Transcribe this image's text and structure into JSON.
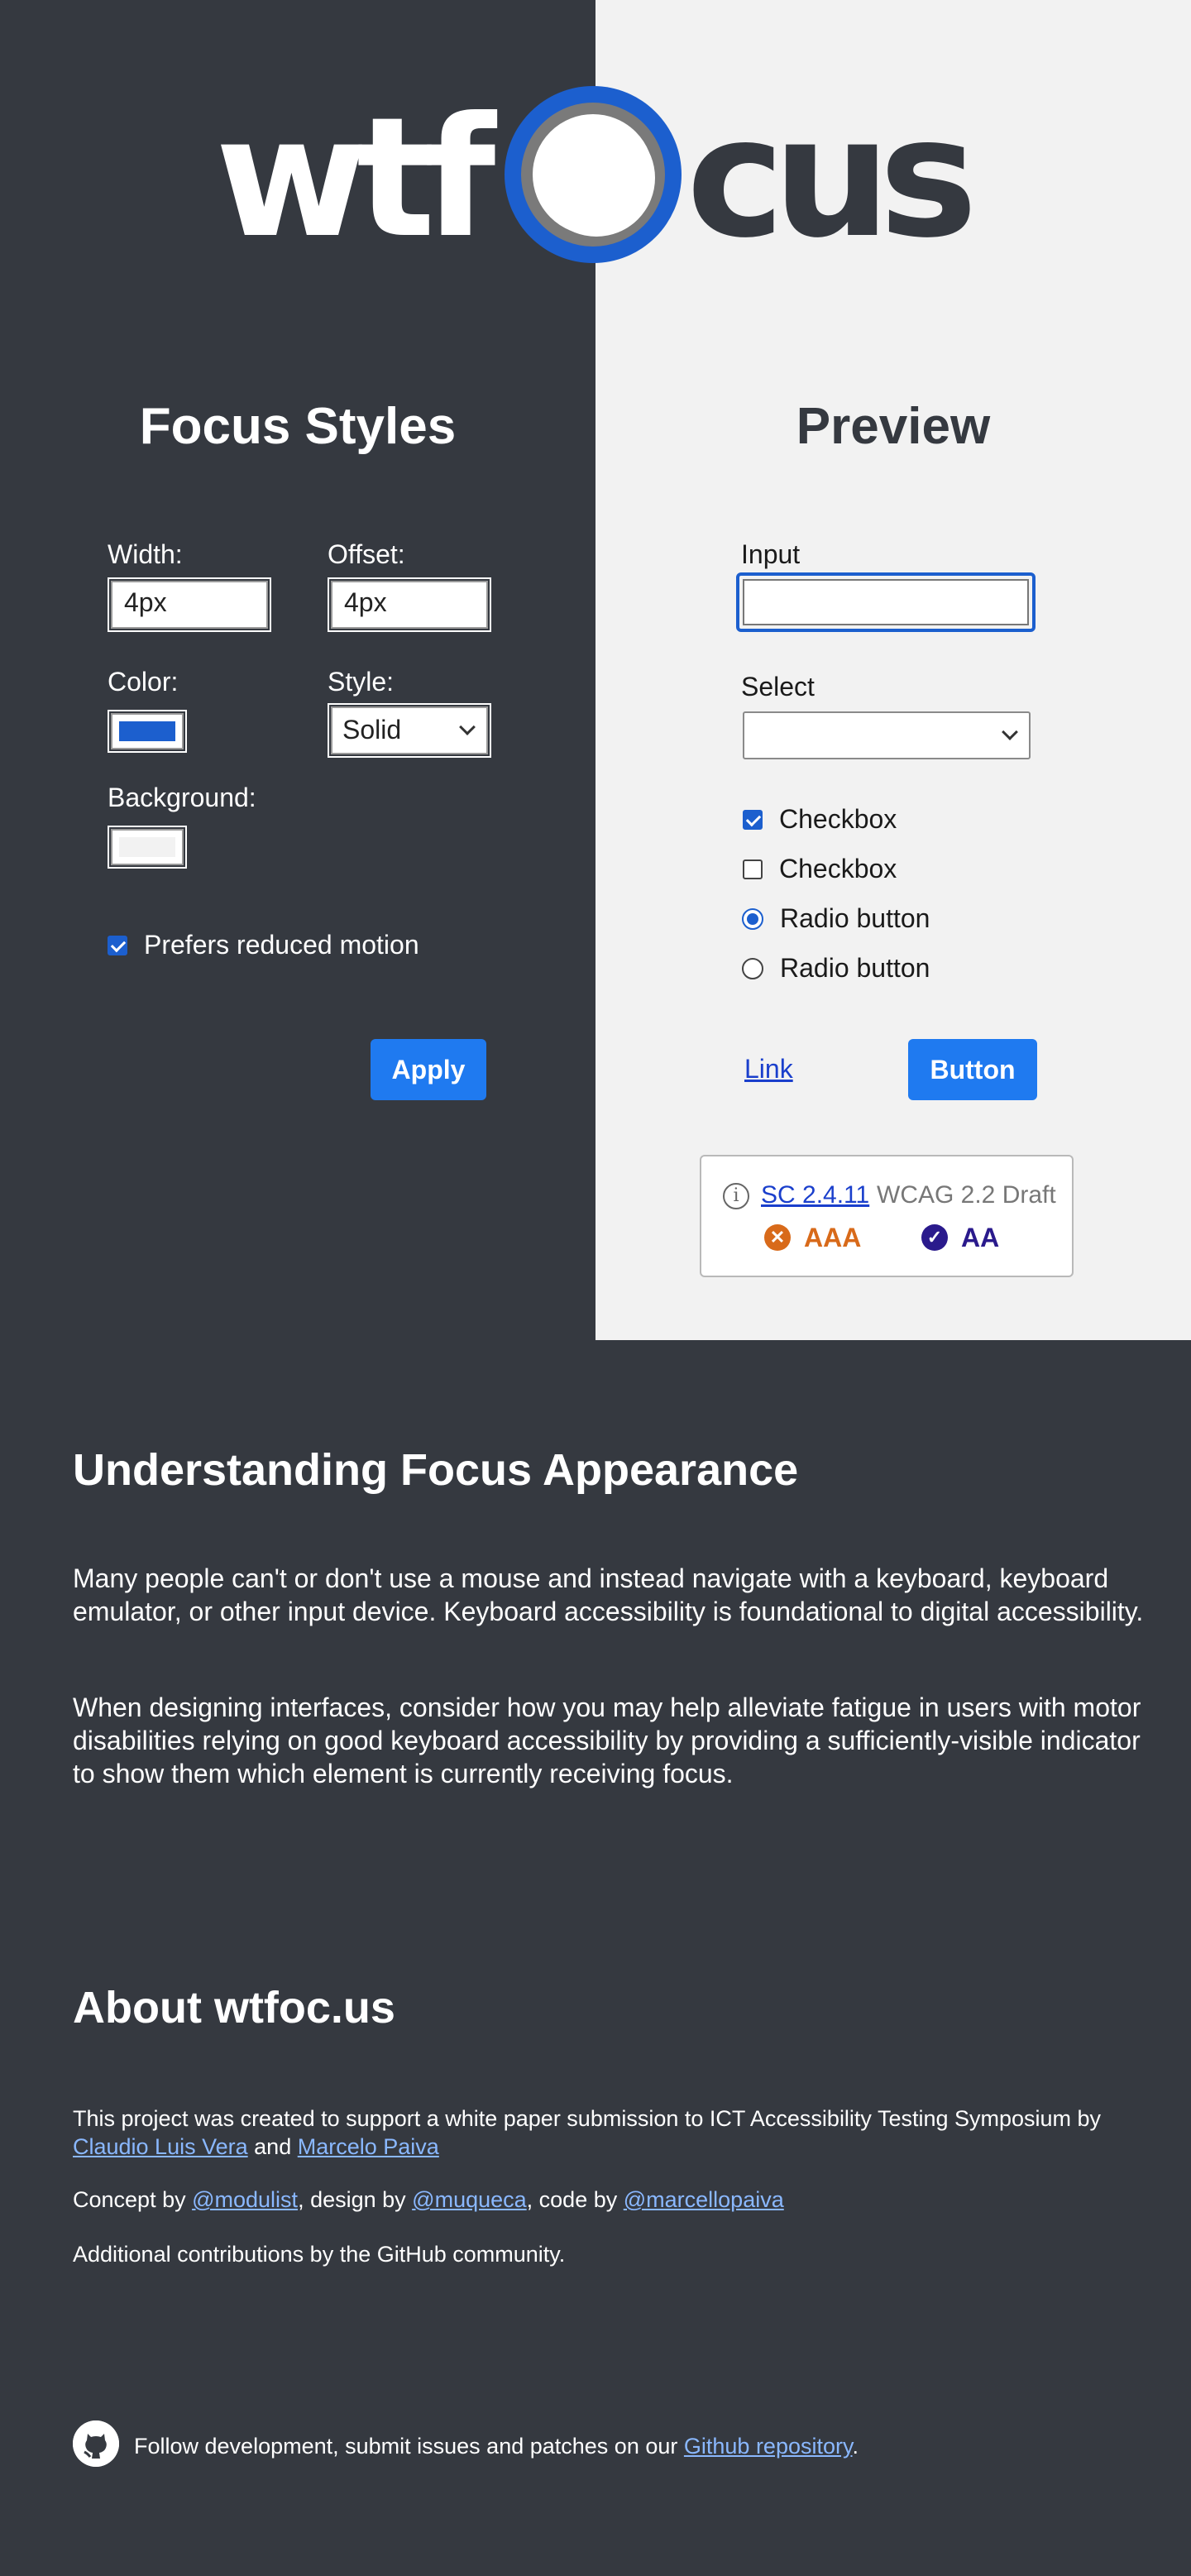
{
  "logo": {
    "part1": "wtf",
    "part2": "cus"
  },
  "controls": {
    "title": "Focus Styles",
    "width_label": "Width:",
    "width_value": "4px",
    "offset_label": "Offset:",
    "offset_value": "4px",
    "color_label": "Color:",
    "color_value": "#1c5fce",
    "style_label": "Style:",
    "style_value": "Solid",
    "background_label": "Background:",
    "background_value": "#f2f2f2",
    "reduced_motion_label": "Prefers reduced motion",
    "reduced_motion_checked": true,
    "apply_label": "Apply"
  },
  "preview": {
    "title": "Preview",
    "input_label": "Input",
    "select_label": "Select",
    "checkbox1_label": "Checkbox",
    "checkbox2_label": "Checkbox",
    "radio1_label": "Radio button",
    "radio2_label": "Radio button",
    "link_label": "Link",
    "button_label": "Button"
  },
  "compliance": {
    "sc_link": "SC 2.4.11",
    "wcag_label": "WCAG 2.2 Draft",
    "aaa_label": "AAA",
    "aaa_status": "fail",
    "aa_label": "AA",
    "aa_status": "pass",
    "fail_color": "#d86a1a",
    "pass_color": "#2a1a8c"
  },
  "understanding": {
    "title": "Understanding Focus Appearance",
    "p1": "Many people can't or don't use a mouse and instead navigate with a keyboard, keyboard emulator, or other input device. Keyboard accessibility is foundational to digital accessibility.",
    "p2": "When designing interfaces, consider how you may help alleviate fatigue in users with motor disabilities relying on good keyboard accessibility by providing a sufficiently-visible indicator to show them which element is currently receiving focus."
  },
  "about": {
    "title": "About wtfoc.us",
    "intro": "This project was created to support a white paper submission to ICT Accessibility Testing Symposium by",
    "author1": "Claudio Luis Vera",
    "and": "and",
    "author2": "Marcelo Paiva",
    "concept_by": "Concept by",
    "concept_handle": "@modulist",
    "design_by": ", design by",
    "design_handle": "@muqueca",
    "code_by": ", code by",
    "code_handle": "@marcellopaiva",
    "community": "Additional contributions by the GitHub community."
  },
  "footer": {
    "text": "Follow development, submit issues and patches on our",
    "link": "Github repository",
    "end": "."
  },
  "colors": {
    "dark_bg": "#353940",
    "light_bg": "#f2f2f2",
    "accent": "#1f7af0",
    "focus_blue": "#1c5fce",
    "link": "#8ab8ff"
  }
}
